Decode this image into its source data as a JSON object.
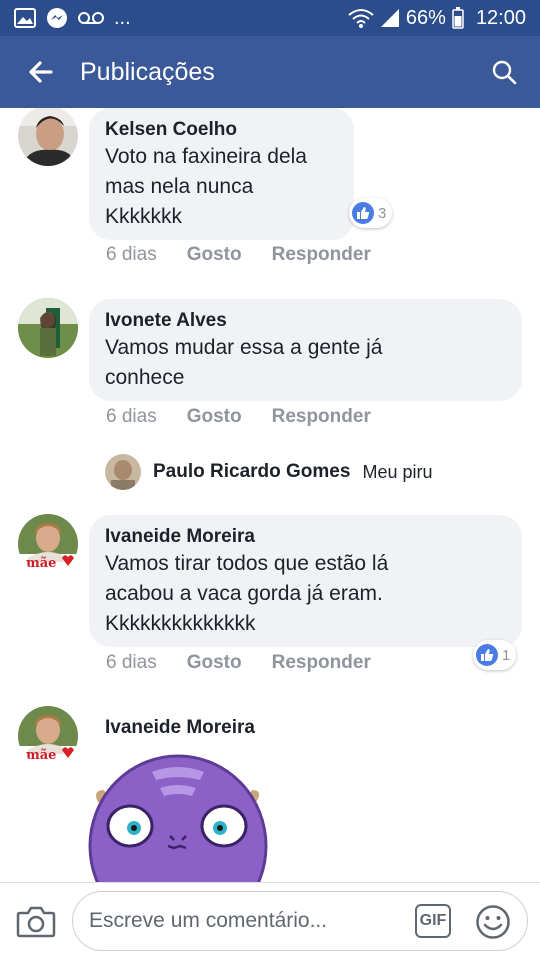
{
  "status_bar": {
    "dots": "...",
    "battery": "66%",
    "time": "12:00",
    "icons": [
      "gallery-icon",
      "messenger-icon",
      "voicemail-icon",
      "wifi-icon",
      "signal-icon",
      "battery-icon"
    ]
  },
  "header": {
    "title": "Publicações",
    "back_icon": "arrow-left-icon",
    "search_icon": "search-icon",
    "color": "#3b5998"
  },
  "comments": [
    {
      "author": "Kelsen Coelho",
      "text_lines": [
        "Voto na faxineira dela",
        "mas nela nunca",
        "Kkkkkkk"
      ],
      "time": "6 dias",
      "like_label": "Gosto",
      "reply_label": "Responder",
      "reactions": "3"
    },
    {
      "author": "Ivonete Alves",
      "text_lines": [
        "Vamos mudar essa a gente já",
        "conhece"
      ],
      "time": "6 dias",
      "like_label": "Gosto",
      "reply_label": "Responder",
      "reply": {
        "author": "Paulo Ricardo Gomes",
        "text": "Meu piru"
      }
    },
    {
      "author": "Ivaneide Moreira",
      "avatar_text": "mãe",
      "text_lines": [
        "Vamos tirar todos que estão lá",
        "acabou a vaca gorda já eram.",
        "Kkkkkkkkkkkkkk"
      ],
      "time": "6 dias",
      "like_label": "Gosto",
      "reply_label": "Responder",
      "reactions": "1"
    },
    {
      "author": "Ivaneide Moreira",
      "avatar_text": "mãe",
      "sticker": "purple-monster-sticker"
    }
  ],
  "composer": {
    "placeholder": "Escreve um comentário...",
    "gif_label": "GIF",
    "camera_icon": "camera-icon",
    "emoji_icon": "smiley-icon"
  }
}
